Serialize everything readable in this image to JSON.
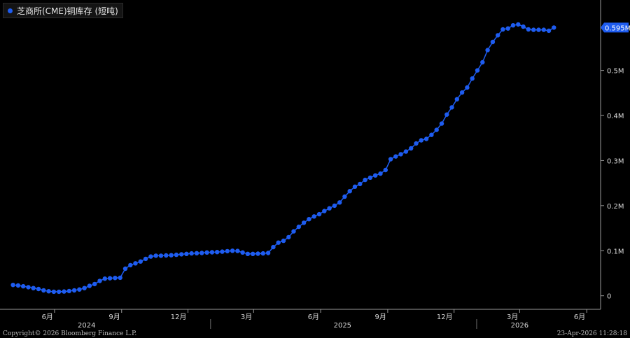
{
  "chart_data": {
    "type": "line",
    "legend": "芝商所(CME)铜库存 (短吨)",
    "last_value_label": "0.595M",
    "y_ticks": [
      {
        "v": 0,
        "label": "0"
      },
      {
        "v": 100000,
        "label": "0.1M"
      },
      {
        "v": 200000,
        "label": "0.2M"
      },
      {
        "v": 300000,
        "label": "0.3M"
      },
      {
        "v": 400000,
        "label": "0.4M"
      },
      {
        "v": 500000,
        "label": "0.5M"
      }
    ],
    "ylim": [
      -30000,
      650000
    ],
    "xlim": [
      "2024-03-22",
      "2026-06-20"
    ],
    "month_ticks": [
      {
        "date": "2024-06-01",
        "label": "6月"
      },
      {
        "date": "2024-09-01",
        "label": "9月"
      },
      {
        "date": "2024-12-01",
        "label": "12月"
      },
      {
        "date": "2025-03-01",
        "label": "3月"
      },
      {
        "date": "2025-06-01",
        "label": "6月"
      },
      {
        "date": "2025-09-01",
        "label": "9月"
      },
      {
        "date": "2025-12-01",
        "label": "12月"
      },
      {
        "date": "2026-03-01",
        "label": "3月"
      },
      {
        "date": "2026-06-01",
        "label": "6月"
      }
    ],
    "year_labels": [
      {
        "date": "2024-07-15",
        "label": "2024"
      },
      {
        "date": "2025-07-01",
        "label": "2025"
      },
      {
        "date": "2026-03-01",
        "label": "2026"
      }
    ],
    "year_separators": [
      "2025-01-01",
      "2026-01-01"
    ],
    "grid": false,
    "series": [
      {
        "color": "#1e5cf0",
        "points": [
          [
            "2024-04-05",
            24000
          ],
          [
            "2024-04-12",
            23000
          ],
          [
            "2024-04-19",
            21000
          ],
          [
            "2024-04-26",
            19000
          ],
          [
            "2024-05-03",
            17000
          ],
          [
            "2024-05-10",
            15000
          ],
          [
            "2024-05-17",
            12000
          ],
          [
            "2024-05-24",
            10000
          ],
          [
            "2024-05-31",
            9000
          ],
          [
            "2024-06-07",
            9000
          ],
          [
            "2024-06-14",
            9500
          ],
          [
            "2024-06-21",
            10500
          ],
          [
            "2024-06-28",
            12000
          ],
          [
            "2024-07-05",
            14000
          ],
          [
            "2024-07-12",
            17000
          ],
          [
            "2024-07-19",
            22000
          ],
          [
            "2024-07-26",
            26000
          ],
          [
            "2024-08-02",
            33000
          ],
          [
            "2024-08-09",
            38000
          ],
          [
            "2024-08-16",
            39000
          ],
          [
            "2024-08-23",
            39500
          ],
          [
            "2024-08-30",
            40000
          ],
          [
            "2024-09-06",
            60000
          ],
          [
            "2024-09-13",
            68000
          ],
          [
            "2024-09-20",
            72000
          ],
          [
            "2024-09-27",
            76000
          ],
          [
            "2024-10-04",
            82000
          ],
          [
            "2024-10-11",
            87000
          ],
          [
            "2024-10-18",
            89000
          ],
          [
            "2024-10-25",
            89000
          ],
          [
            "2024-11-01",
            89500
          ],
          [
            "2024-11-08",
            90000
          ],
          [
            "2024-11-15",
            91000
          ],
          [
            "2024-11-22",
            92000
          ],
          [
            "2024-11-29",
            93000
          ],
          [
            "2024-12-06",
            94000
          ],
          [
            "2024-12-13",
            94500
          ],
          [
            "2024-12-20",
            95000
          ],
          [
            "2024-12-27",
            96000
          ],
          [
            "2025-01-03",
            96500
          ],
          [
            "2025-01-10",
            97000
          ],
          [
            "2025-01-17",
            98000
          ],
          [
            "2025-01-24",
            99000
          ],
          [
            "2025-01-31",
            100000
          ],
          [
            "2025-02-07",
            99500
          ],
          [
            "2025-02-14",
            96000
          ],
          [
            "2025-02-21",
            93000
          ],
          [
            "2025-02-28",
            93000
          ],
          [
            "2025-03-07",
            93500
          ],
          [
            "2025-03-14",
            94000
          ],
          [
            "2025-03-21",
            95000
          ],
          [
            "2025-03-28",
            108000
          ],
          [
            "2025-04-04",
            118000
          ],
          [
            "2025-04-11",
            122000
          ],
          [
            "2025-04-18",
            130000
          ],
          [
            "2025-04-25",
            143000
          ],
          [
            "2025-05-02",
            153000
          ],
          [
            "2025-05-09",
            162000
          ],
          [
            "2025-05-16",
            170000
          ],
          [
            "2025-05-23",
            176000
          ],
          [
            "2025-05-30",
            181000
          ],
          [
            "2025-06-06",
            188000
          ],
          [
            "2025-06-13",
            194000
          ],
          [
            "2025-06-20",
            200000
          ],
          [
            "2025-06-27",
            207000
          ],
          [
            "2025-07-04",
            220000
          ],
          [
            "2025-07-11",
            232000
          ],
          [
            "2025-07-18",
            242000
          ],
          [
            "2025-07-25",
            248000
          ],
          [
            "2025-08-01",
            257000
          ],
          [
            "2025-08-08",
            262000
          ],
          [
            "2025-08-15",
            267000
          ],
          [
            "2025-08-22",
            271000
          ],
          [
            "2025-08-29",
            279000
          ],
          [
            "2025-09-05",
            303000
          ],
          [
            "2025-09-12",
            309000
          ],
          [
            "2025-09-19",
            314000
          ],
          [
            "2025-09-26",
            320000
          ],
          [
            "2025-10-03",
            327000
          ],
          [
            "2025-10-10",
            338000
          ],
          [
            "2025-10-17",
            345000
          ],
          [
            "2025-10-24",
            348000
          ],
          [
            "2025-10-31",
            357000
          ],
          [
            "2025-11-07",
            368000
          ],
          [
            "2025-11-14",
            382000
          ],
          [
            "2025-11-21",
            402000
          ],
          [
            "2025-11-28",
            418000
          ],
          [
            "2025-12-05",
            436000
          ],
          [
            "2025-12-12",
            451000
          ],
          [
            "2025-12-19",
            462000
          ],
          [
            "2025-12-26",
            482000
          ],
          [
            "2026-01-02",
            500000
          ],
          [
            "2026-01-09",
            518000
          ],
          [
            "2026-01-16",
            545000
          ],
          [
            "2026-01-23",
            563000
          ],
          [
            "2026-01-30",
            578000
          ],
          [
            "2026-02-06",
            591000
          ],
          [
            "2026-02-13",
            593000
          ],
          [
            "2026-02-20",
            600000
          ],
          [
            "2026-02-27",
            602000
          ],
          [
            "2026-03-06",
            597000
          ],
          [
            "2026-03-13",
            591000
          ],
          [
            "2026-03-20",
            590000
          ],
          [
            "2026-03-27",
            590000
          ],
          [
            "2026-04-03",
            590000
          ],
          [
            "2026-04-10",
            588000
          ],
          [
            "2026-04-17",
            595000
          ]
        ]
      }
    ]
  },
  "footer": {
    "copyright": "Copyright© 2026 Bloomberg Finance L.P.",
    "timestamp": "23-Apr-2026 11:28:18"
  }
}
